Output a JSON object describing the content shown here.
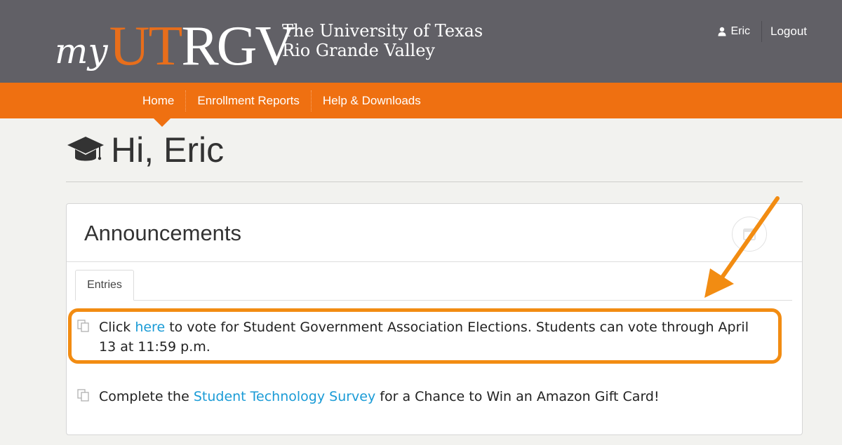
{
  "header": {
    "logo": {
      "my": "my",
      "ut": "UT",
      "rgv": "RGV"
    },
    "university": {
      "line1": "The University of Texas",
      "line2": "Rio Grande Valley"
    },
    "user": {
      "name": "Eric",
      "icon": "person-icon"
    },
    "logout_label": "Logout"
  },
  "nav": {
    "items": [
      {
        "label": "Home"
      },
      {
        "label": "Enrollment Reports"
      },
      {
        "label": "Help & Downloads"
      }
    ],
    "active": "Home"
  },
  "greeting": {
    "icon": "graduation-cap-icon",
    "text": "Hi, Eric"
  },
  "announcements": {
    "title": "Announcements",
    "tab_label": "Entries",
    "entries": [
      {
        "before": "Click ",
        "link": "here",
        "after": " to vote for Student Government Association Elections. Students can vote through April 13 at 11:59 p.m."
      },
      {
        "before": "Complete the ",
        "link": "Student Technology Survey",
        "after": " for a Chance to Win an Amazon Gift Card!"
      }
    ]
  },
  "colors": {
    "header_bg": "#616066",
    "nav_bg": "#ef7011",
    "brand_orange": "#e86e1b",
    "link": "#1a9bd6",
    "annotation": "#f28c12"
  }
}
